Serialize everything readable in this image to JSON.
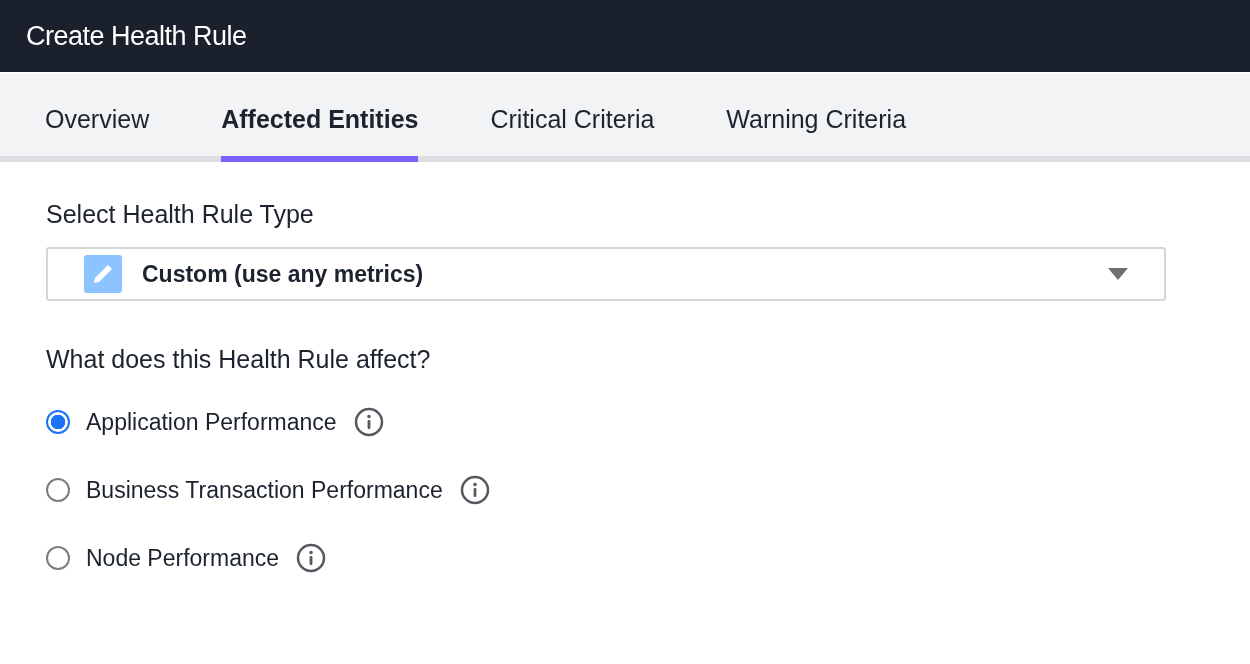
{
  "window": {
    "title": "Create Health Rule"
  },
  "tabs": [
    {
      "label": "Overview",
      "selected": false
    },
    {
      "label": "Affected Entities",
      "selected": true
    },
    {
      "label": "Critical Criteria",
      "selected": false
    },
    {
      "label": "Warning Criteria",
      "selected": false
    }
  ],
  "rule_type": {
    "label": "Select Health Rule Type",
    "value": "Custom (use any metrics)"
  },
  "affects": {
    "label": "What does this Health Rule affect?",
    "options": [
      {
        "label": "Application Performance",
        "selected": true
      },
      {
        "label": "Business Transaction Performance",
        "selected": false
      },
      {
        "label": "Node Performance",
        "selected": false
      }
    ]
  }
}
